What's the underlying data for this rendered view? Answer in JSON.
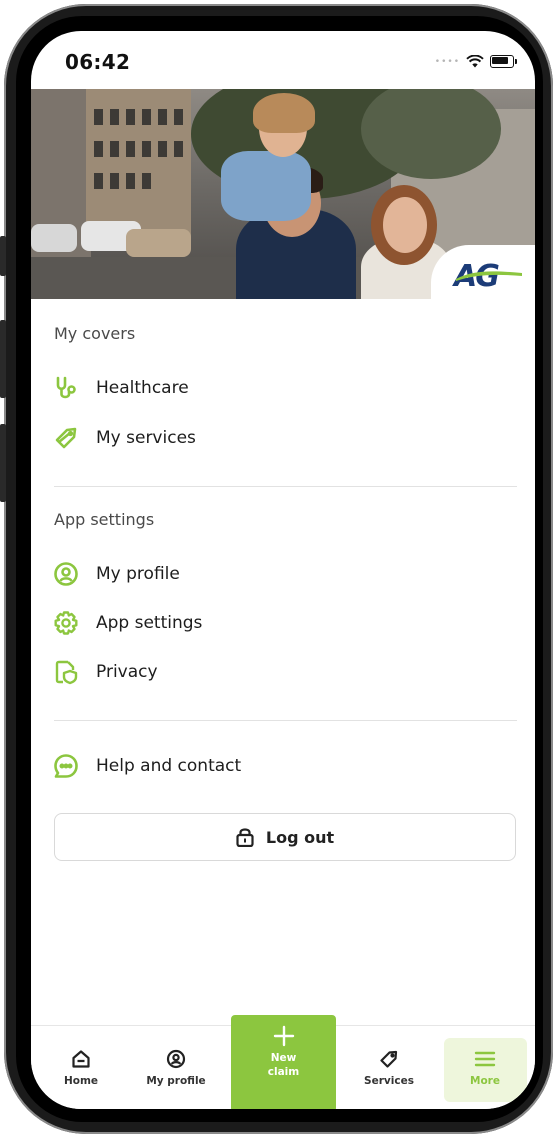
{
  "status_bar": {
    "time": "06:42"
  },
  "colors": {
    "accent": "#8cc63f",
    "brand_blue": "#1c3c78"
  },
  "hero": {
    "logo_text": "AG"
  },
  "sections": {
    "covers_title": "My covers",
    "covers_items": [
      {
        "label": "Healthcare",
        "icon": "stethoscope-icon"
      },
      {
        "label": "My services",
        "icon": "tag-icon"
      }
    ],
    "settings_title": "App settings",
    "settings_items": [
      {
        "label": "My profile",
        "icon": "user-circle-icon"
      },
      {
        "label": "App settings",
        "icon": "gear-icon"
      },
      {
        "label": "Privacy",
        "icon": "shield-document-icon"
      }
    ],
    "help_item": {
      "label": "Help and contact",
      "icon": "chat-bubble-icon"
    }
  },
  "logout": {
    "label": "Log out",
    "icon": "lock-icon"
  },
  "bottom_nav": {
    "home": "Home",
    "profile": "My profile",
    "new_claim": "New claim",
    "services": "Services",
    "more": "More"
  }
}
